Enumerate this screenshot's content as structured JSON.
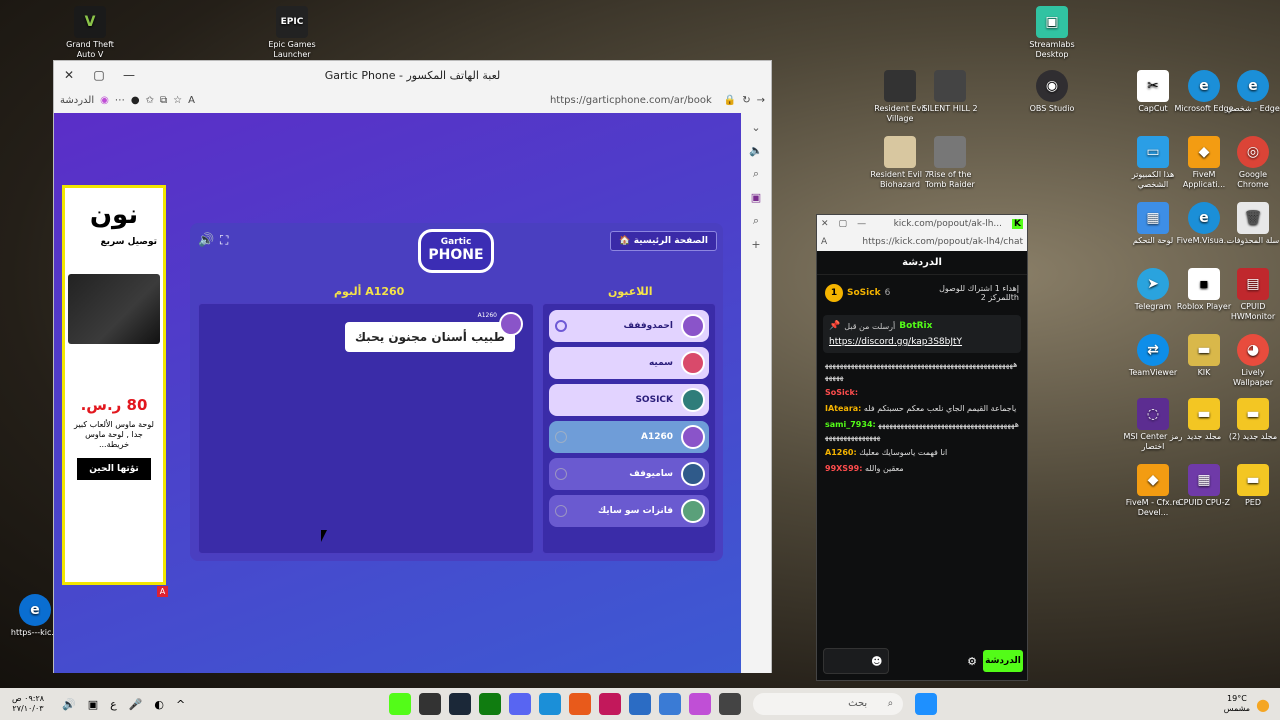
{
  "desktop": {
    "left_icons": [
      {
        "label": "Grand Theft Auto V",
        "color": "#1a1a1a",
        "glyph": "V"
      },
      {
        "label": "Epic Games Launcher",
        "color": "#222222",
        "glyph": "EPIC"
      },
      {
        "label": "https---kic...",
        "color": "#0a6ed1",
        "glyph": "e"
      }
    ],
    "right_icons": [
      {
        "label": "Streamlabs Desktop",
        "color": "#31c3a2",
        "glyph": "▣"
      },
      {
        "label": "Resident Evil Village",
        "color": "#333",
        "glyph": ""
      },
      {
        "label": "SILENT HILL 2",
        "color": "#444",
        "glyph": ""
      },
      {
        "label": "OBS Studio",
        "color": "#302e31",
        "glyph": "◉"
      },
      {
        "label": "CapCut",
        "color": "#fff",
        "glyph": "✂"
      },
      {
        "label": "Microsoft Edge",
        "color": "#1b8fd8",
        "glyph": "e"
      },
      {
        "label": "شخصي - Edge",
        "color": "#1b8fd8",
        "glyph": "e"
      },
      {
        "label": "Resident Evil 7 Biohazard",
        "color": "#d8c7a0",
        "glyph": ""
      },
      {
        "label": "Rise of the Tomb Raider",
        "color": "#777",
        "glyph": ""
      },
      {
        "label": "هذا الكمبيوتر الشخصي",
        "color": "#2a9ee6",
        "glyph": "▭"
      },
      {
        "label": "FiveM Applicati...",
        "color": "#f39c12",
        "glyph": "◆"
      },
      {
        "label": "Google Chrome",
        "color": "#db4437",
        "glyph": "◎"
      },
      {
        "label": "لوحة التحكم",
        "color": "#3d8ee6",
        "glyph": "▦"
      },
      {
        "label": "FiveM.Visua...",
        "color": "#1b8fd8",
        "glyph": "e"
      },
      {
        "label": "سلة المحذوفات",
        "color": "#e8e8e8",
        "glyph": "🗑"
      },
      {
        "label": "Telegram",
        "color": "#2aa3de",
        "glyph": "➤"
      },
      {
        "label": "Roblox Player",
        "color": "#fff",
        "glyph": "▪"
      },
      {
        "label": "CPUID HWMonitor",
        "color": "#c0282d",
        "glyph": "▤"
      },
      {
        "label": "TeamViewer",
        "color": "#0e8ee9",
        "glyph": "⇄"
      },
      {
        "label": "KIK",
        "color": "#d9b84a",
        "glyph": "▬"
      },
      {
        "label": "Lively Wallpaper",
        "color": "#e84c3d",
        "glyph": "◕"
      },
      {
        "label": "MSI Center رمز اختصار",
        "color": "#5c2d91",
        "glyph": "◌"
      },
      {
        "label": "مجلد جديد",
        "color": "#f3c623",
        "glyph": "▬"
      },
      {
        "label": "(2) مجلد جديد",
        "color": "#f3c623",
        "glyph": "▬"
      },
      {
        "label": "FiveM - Cfx.re Devel...",
        "color": "#f39c12",
        "glyph": "◆"
      },
      {
        "label": "CPUID CPU-Z",
        "color": "#6f3aa8",
        "glyph": "▦"
      },
      {
        "label": "PED",
        "color": "#f3c623",
        "glyph": "▬"
      }
    ]
  },
  "browser": {
    "title": "Gartic Phone - لعبة الهاتف المكسور",
    "url": "https://garticphone.com/ar/book",
    "copilot_label": "الدردشة"
  },
  "ad": {
    "brand": "ﻧﻮن",
    "delivery": "توصيل سريع",
    "price": "80 ر.س.",
    "description": "لوحة ماوس الألعاب كبير جدا , لوحة ماوس خريطة...",
    "cta": "تؤتها الحين",
    "badge": "A"
  },
  "game": {
    "home_button": "🏠 الصفحة الرئيسية",
    "logo_line1": "Gartic",
    "logo_line2": "PHONE",
    "album_title": "ألبوم A1260",
    "players_title": "اللاعبون",
    "bubble_text": "طبيب أسنان مجنون يحبك",
    "album_owner": "A1260",
    "players": [
      {
        "name": "احمدوففف",
        "style": "light",
        "avatar": "#8a54c9",
        "mark": "crown"
      },
      {
        "name": "سميه",
        "style": "light",
        "avatar": "#d94a6b",
        "mark": ""
      },
      {
        "name": "SOSICK",
        "style": "light",
        "avatar": "#2f7d7a",
        "mark": ""
      },
      {
        "name": "A1260",
        "style": "teal",
        "avatar": "#8a54c9",
        "mark": "slot"
      },
      {
        "name": "ساميوفف",
        "style": "dim",
        "avatar": "#2f5a8a",
        "mark": "slot"
      },
      {
        "name": "فانزات سو سايك",
        "style": "dim",
        "avatar": "#5aa07a",
        "mark": "slot"
      }
    ]
  },
  "kick": {
    "url_title": "kick.com/popout/ak-lh...",
    "url": "https://kick.com/popout/ak-lh4/chat",
    "header": "الدردشة",
    "top_user": "SoSick",
    "top_user_count": "6",
    "top_note": "إهداء 1 اشتراك للوصول للمركز 2th",
    "pinned_by": "أرسلت من قبل",
    "pinned_user": "BotRix",
    "pinned_link": "https://discord.gg/kap3S8bJtY",
    "messages": [
      {
        "user": "",
        "text": "ﻫﻬﻬﻬﻬﻬﻬﻬﻬﻬﻬﻬﻬﻬﻬﻬﻬﻬﻬﻬﻬﻬﻬﻬﻬﻬﻬﻬﻬﻬﻬﻬﻬﻬﻬﻬﻬﻬﻬﻬﻬﻬﻬﻬﻬﻬﻬﻬﻬﻬﻬﻬﻬﻬﻬﻬﻬ",
        "color": "#ddd"
      },
      {
        "user": "SoSick:",
        "text": "",
        "color": "#ff4d4d"
      },
      {
        "user": "IAteara:",
        "text": "ياجماعة القيمم الجاي نلعب معكم حسبتكم فله",
        "color": "#f5b400"
      },
      {
        "user": "sami_7934:",
        "text": "ﻫﻬﻬﻬﻬﻬﻬﻬﻬﻬﻬﻬﻬﻬﻬﻬﻬﻬﻬﻬﻬﻬﻬﻬﻬﻬﻬﻬﻬﻬﻬﻬﻬﻬﻬﻬﻬﻬﻬﻬﻬﻬﻬﻬﻬﻬﻬﻬﻬﻬﻬﻬﻬ",
        "color": "#53fc18"
      },
      {
        "user": "A1260:",
        "text": "انا فهمت ياسوسايك معليك",
        "color": "#f5b400"
      },
      {
        "user": "99XS99:",
        "text": "معقين والله",
        "color": "#ff4d4d"
      }
    ],
    "chat_button": "الدردشة"
  },
  "taskbar": {
    "search_placeholder": "بحث",
    "time": "٠٩:٢٨ ص",
    "date": "٢٧/١٠/٠٣",
    "weather_temp": "19°C",
    "weather_text": "مشمس"
  }
}
